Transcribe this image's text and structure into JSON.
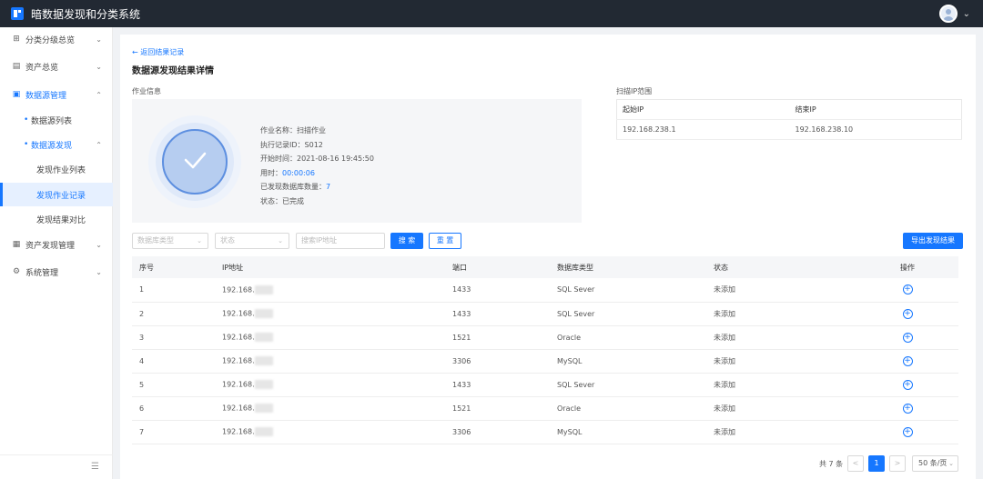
{
  "app": {
    "title": "暗数据发现和分类系统"
  },
  "sidebar": {
    "items": [
      {
        "label": "分类分级总览",
        "icon": "grid-icon",
        "chevron": "⌄"
      },
      {
        "label": "资产总览",
        "icon": "document-icon",
        "chevron": "⌄"
      },
      {
        "label": "数据源管理",
        "icon": "database-icon",
        "chevron": "⌃"
      },
      {
        "label": "数据源列表"
      },
      {
        "label": "数据源发现",
        "chevron": "⌃"
      },
      {
        "label": "发现作业列表"
      },
      {
        "label": "发现作业记录"
      },
      {
        "label": "发现结果对比"
      },
      {
        "label": "资产发现管理",
        "icon": "asset-icon",
        "chevron": "⌄"
      },
      {
        "label": "系统管理",
        "icon": "gear-icon",
        "chevron": "⌄"
      }
    ]
  },
  "page": {
    "back_link": "← 返回结果记录",
    "title": "数据源发现结果详情",
    "job_section_label": "作业信息",
    "ip_section_label": "扫描IP范围"
  },
  "job": {
    "name_label": "作业名称：",
    "name": "扫描作业",
    "record_label": "执行记录ID：",
    "record_id": "S012",
    "start_label": "开始时间：",
    "start_time": "2021-08-16 19:45:50",
    "duration_label": "用时：",
    "duration": "00:00:06",
    "found_label": "已发现数据库数量：",
    "found_count": "7",
    "status_label": "状态：",
    "status": "已完成"
  },
  "ip_range": {
    "headers": [
      "起始IP",
      "结束IP"
    ],
    "start_ip": "192.168.238.1",
    "end_ip": "192.168.238.10"
  },
  "filters": {
    "db_type_placeholder": "数据库类型",
    "status_placeholder": "状态",
    "ip_placeholder": "搜索IP地址",
    "search_label": "搜 索",
    "reset_label": "重 置",
    "export_label": "导出发现结果"
  },
  "table": {
    "headers": [
      "序号",
      "IP地址",
      "端口",
      "数据库类型",
      "状态",
      "操作"
    ],
    "rows": [
      {
        "no": "1",
        "ip": "192.168.",
        "port": "1433",
        "type": "SQL Sever",
        "status": "未添加"
      },
      {
        "no": "2",
        "ip": "192.168.",
        "port": "1433",
        "type": "SQL Sever",
        "status": "未添加"
      },
      {
        "no": "3",
        "ip": "192.168.",
        "port": "1521",
        "type": "Oracle",
        "status": "未添加"
      },
      {
        "no": "4",
        "ip": "192.168.",
        "port": "3306",
        "type": "MySQL",
        "status": "未添加"
      },
      {
        "no": "5",
        "ip": "192.168.",
        "port": "1433",
        "type": "SQL Sever",
        "status": "未添加"
      },
      {
        "no": "6",
        "ip": "192.168.",
        "port": "1521",
        "type": "Oracle",
        "status": "未添加"
      },
      {
        "no": "7",
        "ip": "192.168.",
        "port": "3306",
        "type": "MySQL",
        "status": "未添加"
      }
    ]
  },
  "pagination": {
    "total": "共 7 条",
    "prev": "<",
    "current": "1",
    "next": ">",
    "page_size": "50 条/页"
  },
  "colors": {
    "accent": "#1677ff",
    "topbar": "#222933"
  }
}
